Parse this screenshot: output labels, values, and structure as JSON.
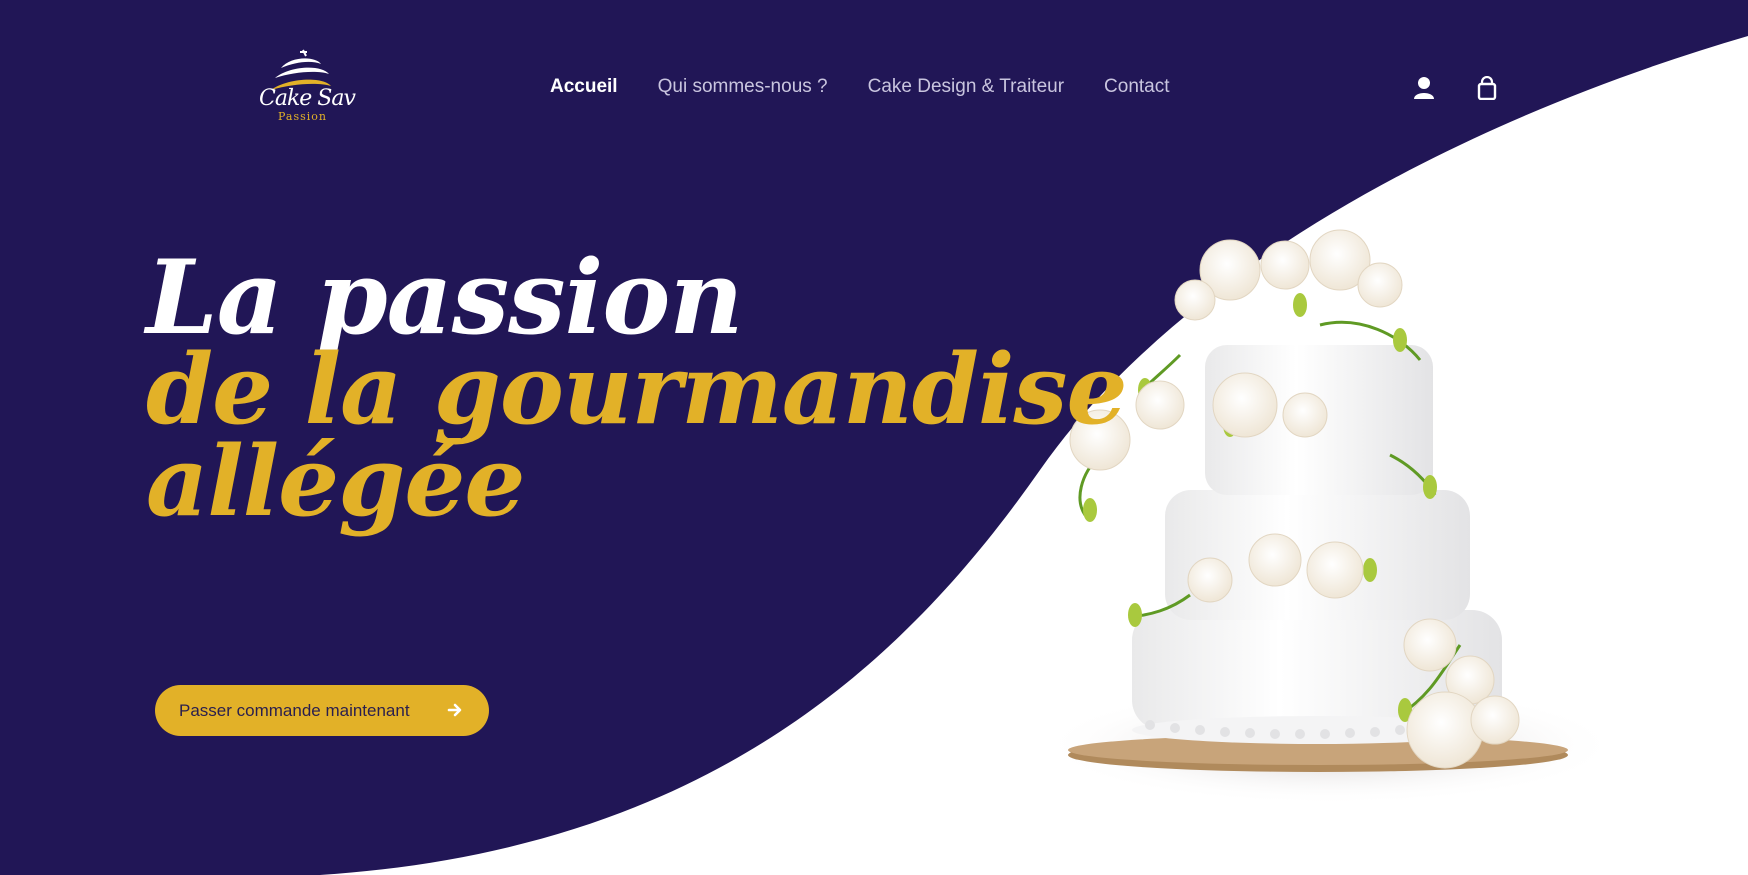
{
  "brand": {
    "logo_script": "Cake Sav",
    "logo_sub": "Passion"
  },
  "nav": {
    "items": [
      {
        "label": "Accueil",
        "active": true
      },
      {
        "label": "Qui sommes-nous ?",
        "active": false
      },
      {
        "label": "Cake Design & Traiteur",
        "active": false
      },
      {
        "label": "Contact",
        "active": false
      }
    ]
  },
  "header_icons": [
    "user-icon",
    "shopping-bag-icon"
  ],
  "hero": {
    "line1": "La passion",
    "line2": "de la gourmandise",
    "line3": "allégée",
    "cta_label": "Passer commande maintenant",
    "cta_icon": "arrow-right-icon",
    "image": "wedding-cake-image"
  },
  "colors": {
    "background": "#211656",
    "accent": "#e2b128",
    "curve": "#ffffff",
    "nav_text": "#c9c5df"
  }
}
